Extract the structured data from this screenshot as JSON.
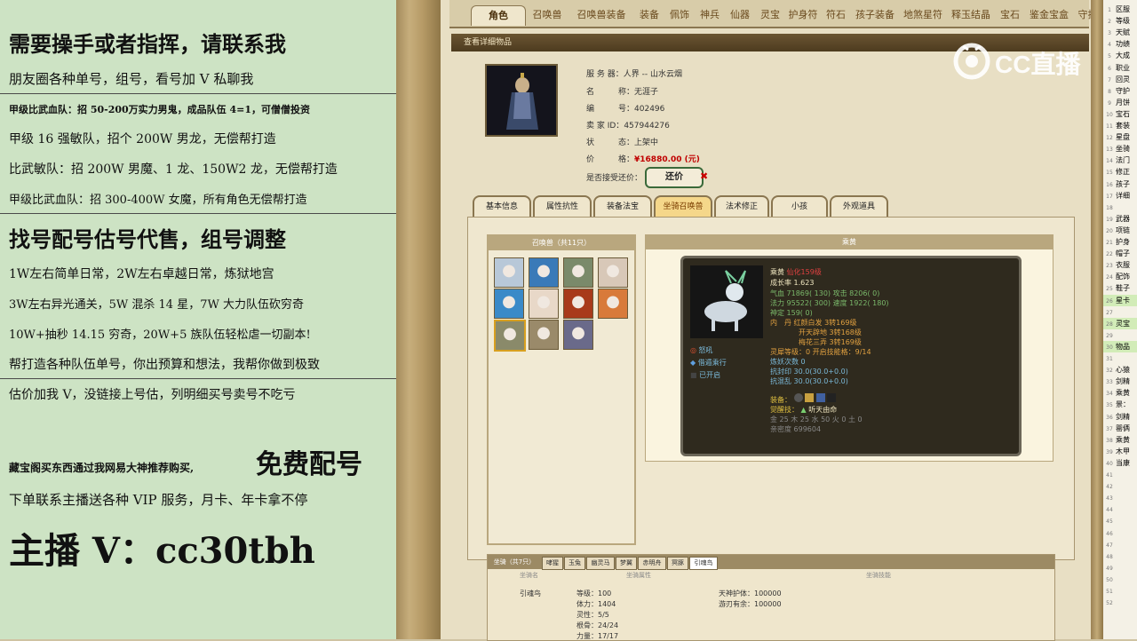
{
  "ad": {
    "l1": "需要操手或者指挥，请联系我",
    "l2": "朋友圈各种单号，组号，看号加 V 私聊我",
    "l3": "甲级比武血队：招 50-200万实力男鬼，成品队伍 4=1，可僧僧投资",
    "l4": "甲级 16 强敏队，招个 200W 男龙，无偿帮打造",
    "l5": "比武敏队：招 200W 男魔、1 龙、150W2 龙，无偿帮打造",
    "l6": "甲级比武血队：招 300-400W 女魔，所有角色无偿帮打造",
    "l7": "找号配号估号代售，组号调整",
    "l8": "1W左右简单日常，2W左右卓越日常，炼狱地宫",
    "l9": "3W左右异光通关，5W 混杀 14 星，7W 大力队伍砍穷奇",
    "l10": "10W+抽秒 14.15 穷奇，20W+5 族队伍轻松虐一切副本!",
    "l11": "帮打造各种队伍单号，你出预算和想法，我帮你做到极致",
    "l12": "估价加我 V，没链接上号估，列明细买号卖号不吃亏",
    "l13a": "藏宝阁买东西通过我网易大神推荐购买,",
    "l13b": "免费配号",
    "l14": "下单联系主播送各种 VIP 服务，月卡、年卡拿不停",
    "l15": "主播 V：cc30tbh"
  },
  "tabs": [
    "角色",
    "召唤兽",
    "召唤兽装备",
    "装备",
    "佩饰",
    "神兵",
    "仙器",
    "灵宝",
    "护身符",
    "符石",
    "孩子装备",
    "地煞星符",
    "释玉结晶",
    "宝石",
    "鉴金宝盒",
    "守护石"
  ],
  "header_title": "查看详细物品",
  "info": {
    "server_k": "服 务 器：",
    "server_v": "人界 -- 山水云烟",
    "name_k": "名　　　称：",
    "name_v": "无涯子",
    "id_k": "编　　　号：",
    "id_v": "402496",
    "seller_k": "卖 家 ID：",
    "seller_v": "457944276",
    "status_k": "状　　　态：",
    "status_v": "上架中",
    "price_k": "价　　　格：",
    "price_v": "¥16880.00 (元)",
    "counter_k": "是否接受还价：",
    "counter_btn": "还价"
  },
  "subtabs": [
    "基本信息",
    "属性抗性",
    "装备法宝",
    "坐骑召唤兽",
    "法术修正",
    "小孩",
    "外观道具"
  ],
  "pets": {
    "title": "召唤兽（共11只）",
    "icon_colors": [
      "#b8c8d8",
      "#3a7ab8",
      "#7a8a6a",
      "#d8c8b8",
      "#3a8ac8",
      "#e8d8c8",
      "#a83a1a",
      "#d87a3a",
      "#8a8a6a",
      "#9a8a6a",
      "#6a6a8a"
    ]
  },
  "detail": {
    "title": "乘黄",
    "name": "乘黄",
    "level": "仙化159级",
    "growth": "成长率 1.623",
    "hp": "气血 71869( 130) 攻击 8206( 0)",
    "mp": "法力 95522( 300) 速度 1922( 180)",
    "shen": "神定 159( 0)",
    "dan1": "内　丹 红颜白发 3转169级",
    "dan2": "开天辟地 3转168级",
    "dan3": "梅花三弄 3转169级",
    "skill1": "怒吼",
    "skill2": "借遁乘行",
    "skill3": "已开启",
    "soul": "灵犀等级：0 开启技能格：9/14",
    "lianyao": "炼妖次数 0",
    "kang1": "抗封印 30.0(30.0+0.0)",
    "kang2": "抗混乱 30.0(30.0+0.0)",
    "equip": "装备：",
    "awaken": "觉醒技：",
    "awaken_v": "听天由命",
    "wuxing": "金 25 木 25 水 50 火 0 土 0",
    "qinmi": "亲密度 699604"
  },
  "mount": {
    "tabs": [
      "坐骑（共7只）",
      "哮猩",
      "玉兔",
      "幽灵马",
      "梦翼",
      "赤明舟",
      "冥豚",
      "引魂鸟"
    ],
    "col1": "坐骑名",
    "col2": "坐骑属性",
    "col3": "坐骑技能",
    "name": "引魂鸟",
    "lv": "等级：100",
    "tili": "体力：1404",
    "lingxing": "灵性：5/5",
    "gen": "根骨：24/24",
    "liliang": "力量：17/17",
    "sk1": "天神护体：100000",
    "sk2": "游刃有余：100000"
  },
  "right_items": [
    {
      "n": "1",
      "t": "区服"
    },
    {
      "n": "2",
      "t": "等级"
    },
    {
      "n": "3",
      "t": "天赋"
    },
    {
      "n": "4",
      "t": "功绩"
    },
    {
      "n": "5",
      "t": "大成"
    },
    {
      "n": "6",
      "t": "职业"
    },
    {
      "n": "7",
      "t": "回灵"
    },
    {
      "n": "8",
      "t": "守护"
    },
    {
      "n": "9",
      "t": "月饼"
    },
    {
      "n": "10",
      "t": "宝石"
    },
    {
      "n": "11",
      "t": "套装"
    },
    {
      "n": "12",
      "t": "星盘"
    },
    {
      "n": "13",
      "t": "坐骑"
    },
    {
      "n": "14",
      "t": "法门"
    },
    {
      "n": "15",
      "t": "修正"
    },
    {
      "n": "16",
      "t": "孩子"
    },
    {
      "n": "17",
      "t": "详细"
    },
    {
      "n": "18",
      "t": ""
    },
    {
      "n": "19",
      "t": "武器"
    },
    {
      "n": "20",
      "t": "项链"
    },
    {
      "n": "21",
      "t": "护身"
    },
    {
      "n": "22",
      "t": "帽子"
    },
    {
      "n": "23",
      "t": "衣服"
    },
    {
      "n": "24",
      "t": "配饰"
    },
    {
      "n": "25",
      "t": "鞋子"
    },
    {
      "n": "26",
      "t": "星卡"
    },
    {
      "n": "27",
      "t": ""
    },
    {
      "n": "28",
      "t": "灵宝"
    },
    {
      "n": "29",
      "t": ""
    },
    {
      "n": "30",
      "t": "物品"
    },
    {
      "n": "31",
      "t": ""
    },
    {
      "n": "32",
      "t": "心猿"
    },
    {
      "n": "33",
      "t": "剑精"
    },
    {
      "n": "34",
      "t": "乘黄"
    },
    {
      "n": "35",
      "t": "景："
    },
    {
      "n": "36",
      "t": "剑精"
    },
    {
      "n": "37",
      "t": "罂俩"
    },
    {
      "n": "38",
      "t": "乘黄"
    },
    {
      "n": "39",
      "t": "木甲"
    },
    {
      "n": "40",
      "t": "当康"
    },
    {
      "n": "41",
      "t": ""
    },
    {
      "n": "42",
      "t": ""
    },
    {
      "n": "43",
      "t": ""
    },
    {
      "n": "44",
      "t": ""
    },
    {
      "n": "45",
      "t": ""
    },
    {
      "n": "46",
      "t": ""
    },
    {
      "n": "47",
      "t": ""
    },
    {
      "n": "48",
      "t": ""
    },
    {
      "n": "49",
      "t": ""
    },
    {
      "n": "50",
      "t": ""
    },
    {
      "n": "51",
      "t": ""
    },
    {
      "n": "52",
      "t": ""
    }
  ],
  "watermark": "CC直播"
}
